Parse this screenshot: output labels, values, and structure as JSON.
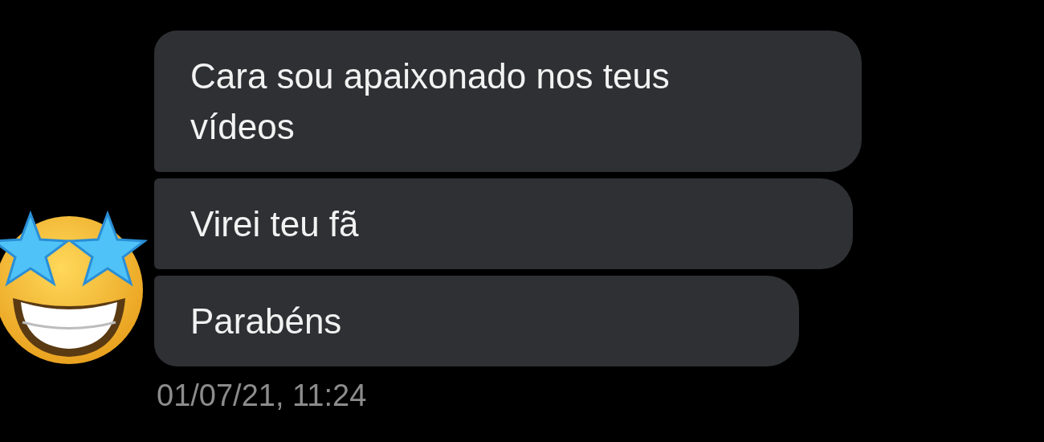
{
  "messages": [
    {
      "text": "Cara sou apaixonado nos teus vídeos",
      "kind": "first"
    },
    {
      "text": "Virei teu fã",
      "kind": "middle"
    },
    {
      "text": "Parabéns",
      "kind": "last"
    }
  ],
  "timestamp": "01/07/21, 11:24"
}
